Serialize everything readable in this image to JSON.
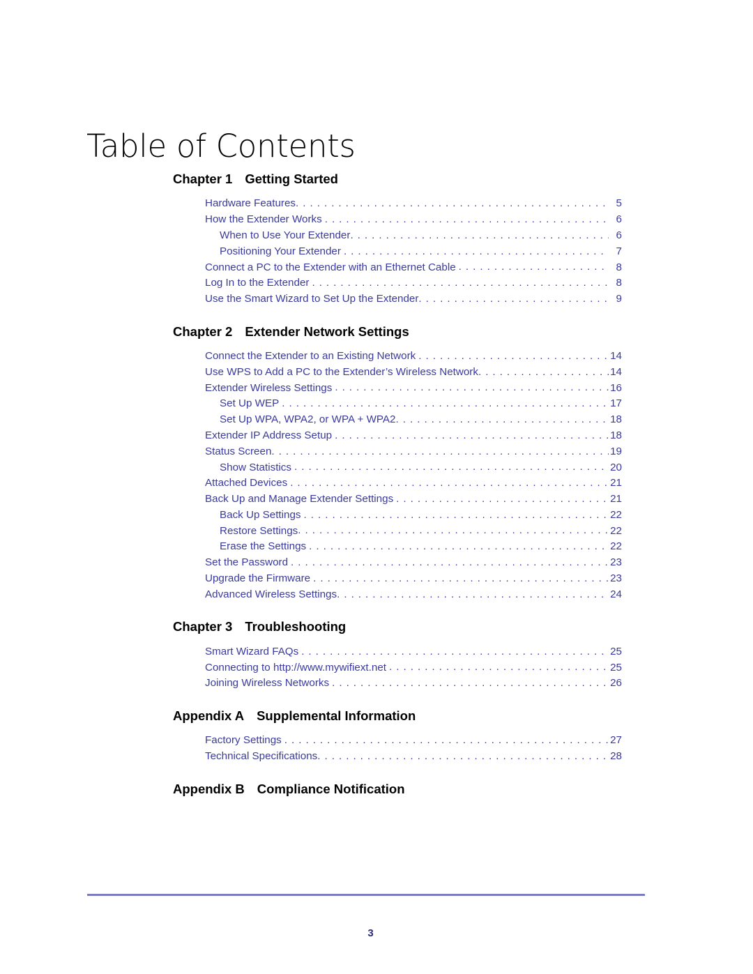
{
  "document": {
    "title": "Table of Contents",
    "page_number": "3"
  },
  "sections": [
    {
      "label": "Chapter 1",
      "title": "Getting Started",
      "entries": [
        {
          "text": "Hardware Features",
          "page": "5",
          "level": 1,
          "tight": true
        },
        {
          "text": "How the Extender Works",
          "page": "6",
          "level": 1,
          "tight": false
        },
        {
          "text": "When to Use Your Extender",
          "page": "6",
          "level": 2,
          "tight": true
        },
        {
          "text": "Positioning Your Extender",
          "page": "7",
          "level": 2,
          "tight": false
        },
        {
          "text": "Connect a PC to the Extender with an Ethernet Cable",
          "page": "8",
          "level": 1,
          "tight": false
        },
        {
          "text": "Log In to the Extender",
          "page": "8",
          "level": 1,
          "tight": false
        },
        {
          "text": "Use the Smart Wizard to Set Up the Extender",
          "page": "9",
          "level": 1,
          "tight": true
        }
      ]
    },
    {
      "label": "Chapter 2",
      "title": "Extender Network Settings",
      "entries": [
        {
          "text": "Connect the Extender to an Existing Network",
          "page": "14",
          "level": 1,
          "tight": false
        },
        {
          "text": "Use WPS to Add a PC to the Extender’s Wireless Network",
          "page": "14",
          "level": 1,
          "tight": true
        },
        {
          "text": "Extender Wireless Settings",
          "page": "16",
          "level": 1,
          "tight": false
        },
        {
          "text": "Set Up WEP",
          "page": "17",
          "level": 2,
          "tight": false
        },
        {
          "text": "Set Up WPA, WPA2, or WPA + WPA2",
          "page": "18",
          "level": 2,
          "tight": true
        },
        {
          "text": "Extender IP Address Setup",
          "page": "18",
          "level": 1,
          "tight": false
        },
        {
          "text": "Status Screen",
          "page": "19",
          "level": 1,
          "tight": true
        },
        {
          "text": "Show Statistics",
          "page": "20",
          "level": 2,
          "tight": false
        },
        {
          "text": "Attached Devices",
          "page": "21",
          "level": 1,
          "tight": false
        },
        {
          "text": "Back Up and Manage Extender Settings",
          "page": "21",
          "level": 1,
          "tight": false
        },
        {
          "text": "Back Up Settings",
          "page": "22",
          "level": 2,
          "tight": false
        },
        {
          "text": "Restore Settings",
          "page": "22",
          "level": 2,
          "tight": true
        },
        {
          "text": "Erase the Settings",
          "page": "22",
          "level": 2,
          "tight": false
        },
        {
          "text": "Set the Password",
          "page": "23",
          "level": 1,
          "tight": false
        },
        {
          "text": "Upgrade the Firmware",
          "page": "23",
          "level": 1,
          "tight": false
        },
        {
          "text": "Advanced Wireless Settings",
          "page": "24",
          "level": 1,
          "tight": true
        }
      ]
    },
    {
      "label": "Chapter 3",
      "title": "Troubleshooting",
      "entries": [
        {
          "text": "Smart Wizard FAQs",
          "page": "25",
          "level": 1,
          "tight": false
        },
        {
          "text": "Connecting to http://www.mywifiext.net",
          "page": "25",
          "level": 1,
          "tight": false
        },
        {
          "text": "Joining Wireless Networks",
          "page": "26",
          "level": 1,
          "tight": false
        }
      ]
    },
    {
      "label": "Appendix A",
      "title": "Supplemental Information",
      "entries": [
        {
          "text": "Factory Settings",
          "page": "27",
          "level": 1,
          "tight": false
        },
        {
          "text": "Technical Specifications",
          "page": "28",
          "level": 1,
          "tight": true
        }
      ]
    },
    {
      "label": "Appendix B",
      "title": "Compliance Notification",
      "entries": []
    }
  ]
}
